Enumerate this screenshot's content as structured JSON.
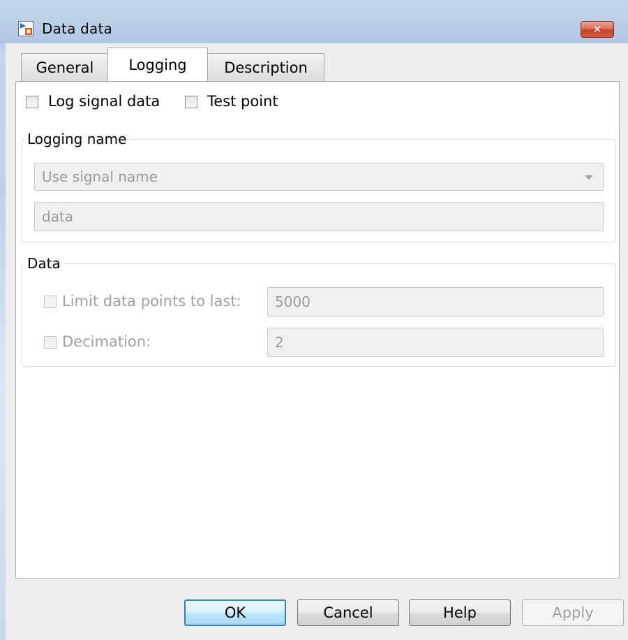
{
  "window": {
    "title": "Data data",
    "close_glyph": "✕",
    "icon": "simulink-data-icon"
  },
  "tabs": [
    {
      "label": "General",
      "active": false
    },
    {
      "label": "Logging",
      "active": true
    },
    {
      "label": "Description",
      "active": false
    }
  ],
  "logging": {
    "log_signal_data": {
      "label": "Log signal data",
      "checked": false
    },
    "test_point": {
      "label": "Test point",
      "checked": false
    },
    "logging_name_group": {
      "title": "Logging name",
      "mode_select": {
        "value": "Use signal name",
        "enabled": false
      },
      "name_field": {
        "value": "data",
        "enabled": false
      }
    },
    "data_group": {
      "title": "Data",
      "limit_points": {
        "label": "Limit data points to last:",
        "checked": false,
        "value": "5000",
        "enabled": false
      },
      "decimation": {
        "label": "Decimation:",
        "checked": false,
        "value": "2",
        "enabled": false
      }
    }
  },
  "buttons": {
    "ok": "OK",
    "cancel": "Cancel",
    "help": "Help",
    "apply": "Apply"
  },
  "colors": {
    "default_button_border": "#3c7fb1",
    "close_button": "#c7402a",
    "disabled_text": "#a0a0a0"
  }
}
